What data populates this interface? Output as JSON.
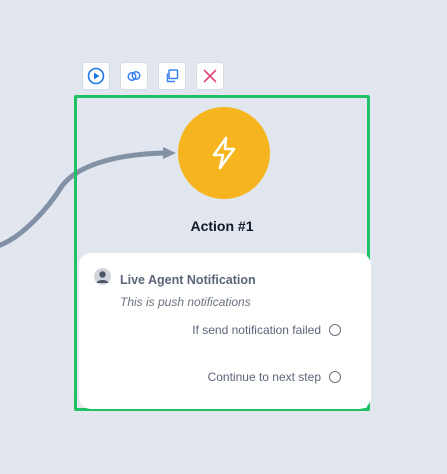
{
  "toolbar": {
    "buttons": [
      {
        "name": "run-button",
        "icon": "play-circle-icon"
      },
      {
        "name": "link-button",
        "icon": "link-icon"
      },
      {
        "name": "duplicate-button",
        "icon": "copy-icon"
      },
      {
        "name": "delete-button",
        "icon": "close-icon"
      }
    ]
  },
  "node": {
    "title": "Action #1",
    "icon": "lightning-bolt-icon",
    "accent_color": "#f6b51e",
    "selected_border_color": "#1ec264"
  },
  "card": {
    "avatar_icon": "agent-avatar-icon",
    "title": "Live Agent Notification",
    "subtitle": "This is push notifications",
    "outlets": [
      {
        "label": "If send notification failed"
      },
      {
        "label": "Continue to next step"
      }
    ]
  }
}
